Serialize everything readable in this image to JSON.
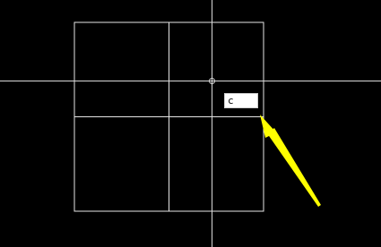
{
  "canvas": {
    "background_color": "#000000",
    "line_color": "#e6e6e6",
    "crosshair_color": "#d9d9d9"
  },
  "drawing": {
    "outer_rectangle": "grid-rectangle",
    "divisions": {
      "columns": 2,
      "rows": 2
    }
  },
  "cursor": {
    "icon": "crosshair-pickbox-icon"
  },
  "dynamic_input": {
    "value": "c"
  },
  "annotation": {
    "icon": "arrow-pointer-icon",
    "color": "#ffff00"
  }
}
